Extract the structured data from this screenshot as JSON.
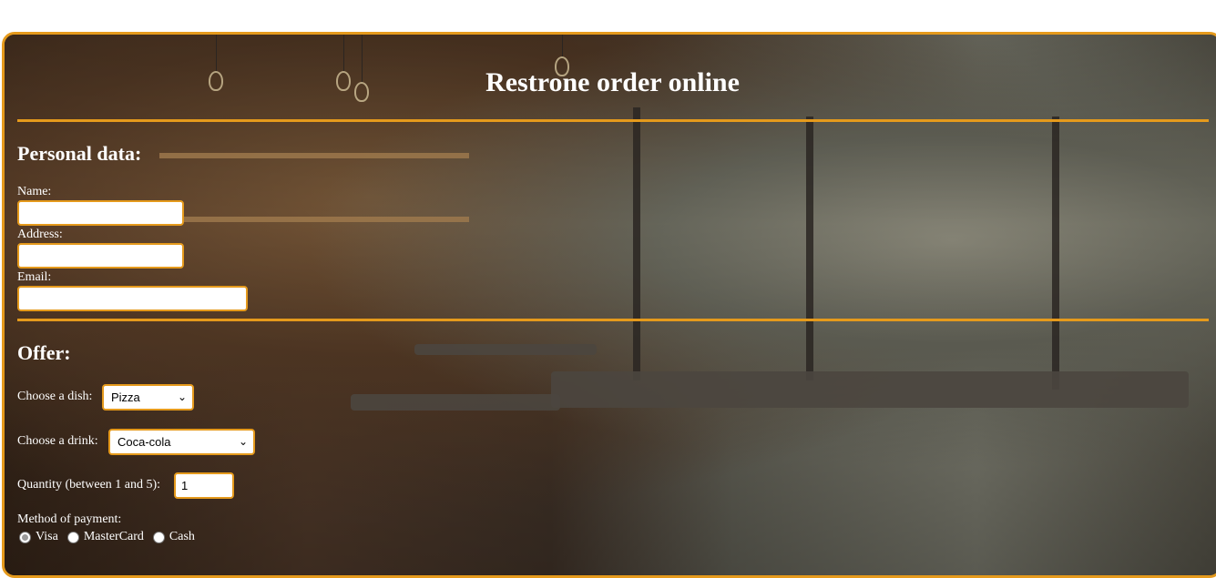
{
  "header": {
    "title": "Restrone order online"
  },
  "personal": {
    "heading": "Personal data:",
    "name_label": "Name:",
    "address_label": "Address:",
    "email_label": "Email:"
  },
  "offer": {
    "heading": "Offer:",
    "dish_label": "Choose a dish:",
    "dish_selected": "Pizza",
    "drink_label": "Choose a drink:",
    "drink_selected": "Coca-cola",
    "quantity_label": "Quantity (between 1 and 5):",
    "quantity_value": "1",
    "payment_label": "Method of payment:",
    "payment_options": [
      "Visa",
      "MasterCard",
      "Cash"
    ]
  },
  "colors": {
    "accent": "#e59a1c",
    "text": "#ffffff"
  },
  "icons": {
    "select_arrow": "chevron-down-icon"
  }
}
